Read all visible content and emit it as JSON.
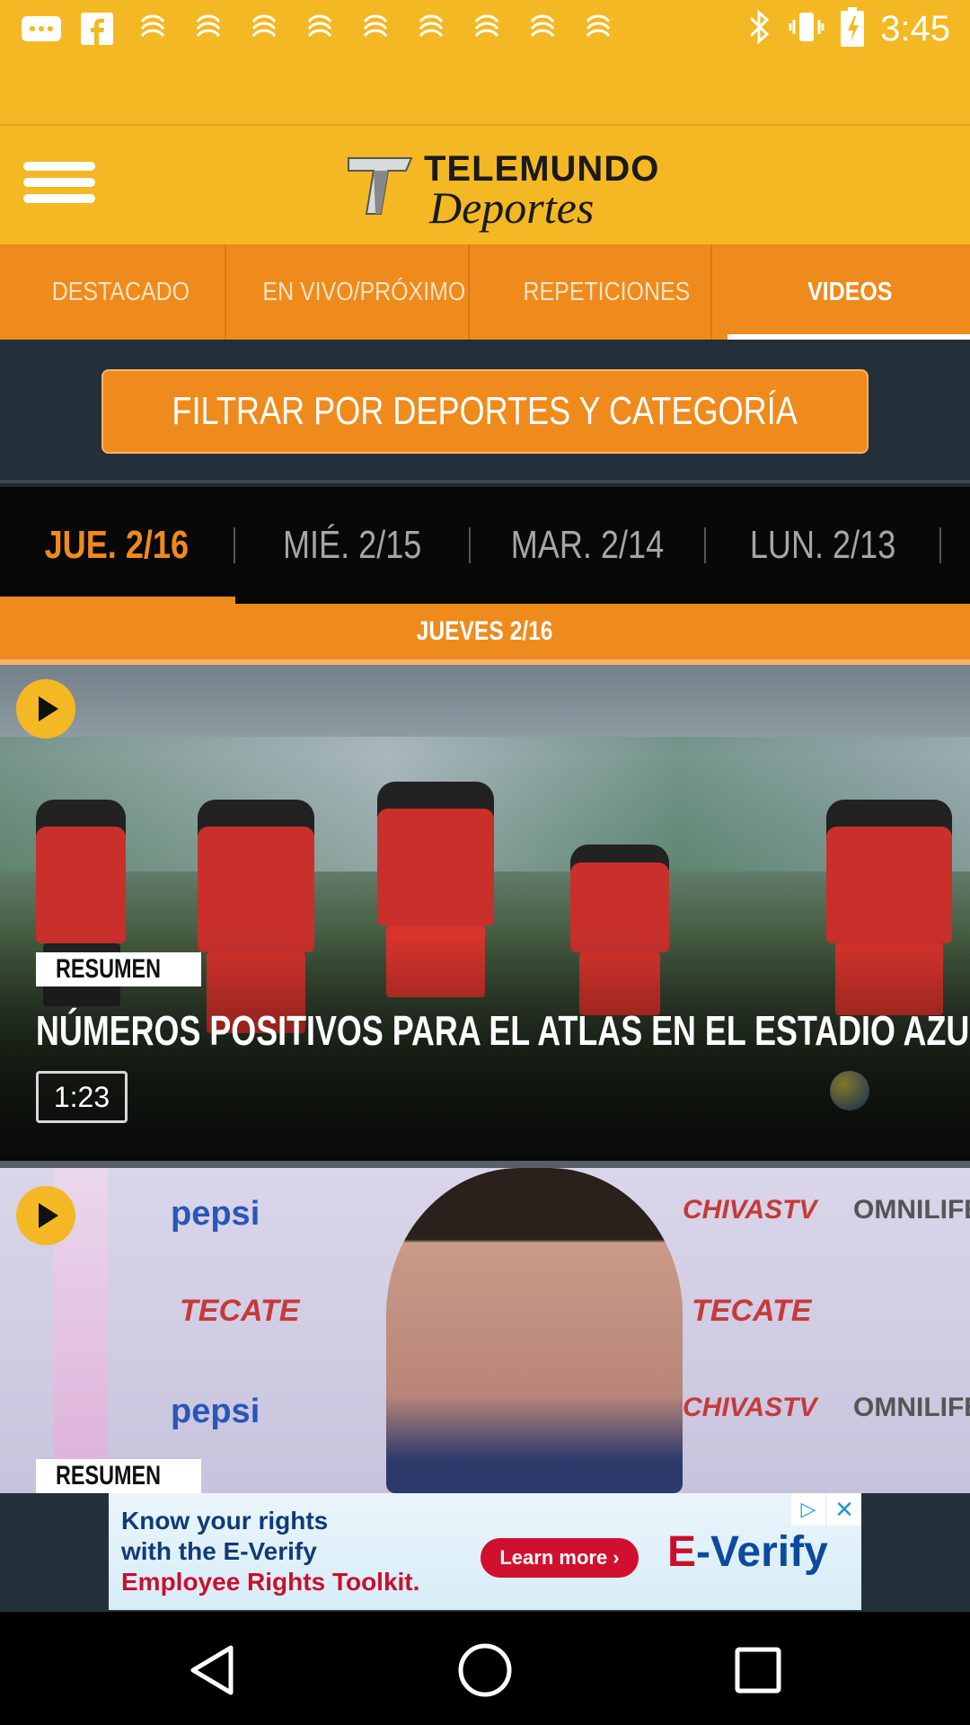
{
  "status_bar": {
    "time": "3:45",
    "notification_icons": [
      "message-icon",
      "facebook-icon",
      "app-notification-icon",
      "app-notification-icon",
      "app-notification-icon",
      "app-notification-icon",
      "app-notification-icon",
      "app-notification-icon",
      "app-notification-icon",
      "app-notification-icon",
      "app-notification-icon"
    ],
    "system_icons": [
      "bluetooth-icon",
      "vibrate-icon",
      "battery-charging-icon"
    ]
  },
  "header": {
    "logo_line1": "TELEMUNDO",
    "logo_line2": "Deportes"
  },
  "tabs": [
    {
      "label": "DESTACADO",
      "active": false
    },
    {
      "label": "EN VIVO/PRÓXIMO",
      "active": false
    },
    {
      "label": "REPETICIONES",
      "active": false
    },
    {
      "label": "VIDEOS",
      "active": true
    }
  ],
  "filter": {
    "label": "FILTRAR POR DEPORTES Y CATEGORÍA"
  },
  "dates": [
    {
      "label": "JUE. 2/16",
      "active": true
    },
    {
      "label": "MIÉ. 2/15",
      "active": false
    },
    {
      "label": "MAR. 2/14",
      "active": false
    },
    {
      "label": "LUN. 2/13",
      "active": false
    }
  ],
  "day_header": "JUEVES  2/16",
  "videos": [
    {
      "badge": "RESUMEN",
      "title": "NÚMEROS POSITIVOS PARA EL ATLAS EN EL ESTADIO AZUL",
      "duration": "1:23"
    },
    {
      "badge": "RESUMEN",
      "title": "",
      "duration": ""
    }
  ],
  "card2_backdrop": {
    "logos": [
      "pepsi",
      "TECATE",
      "CHIVASTV",
      "OMNILIFE"
    ]
  },
  "ad": {
    "line1": "Know your rights",
    "line2": "with the E-Verify",
    "line3": "Employee Rights Toolkit.",
    "cta": "Learn more ›",
    "brand_e": "E",
    "brand_rest": "-Verify"
  },
  "colors": {
    "yellow": "#f3b823",
    "orange": "#ef8a1c",
    "dark": "#1f2a33"
  }
}
